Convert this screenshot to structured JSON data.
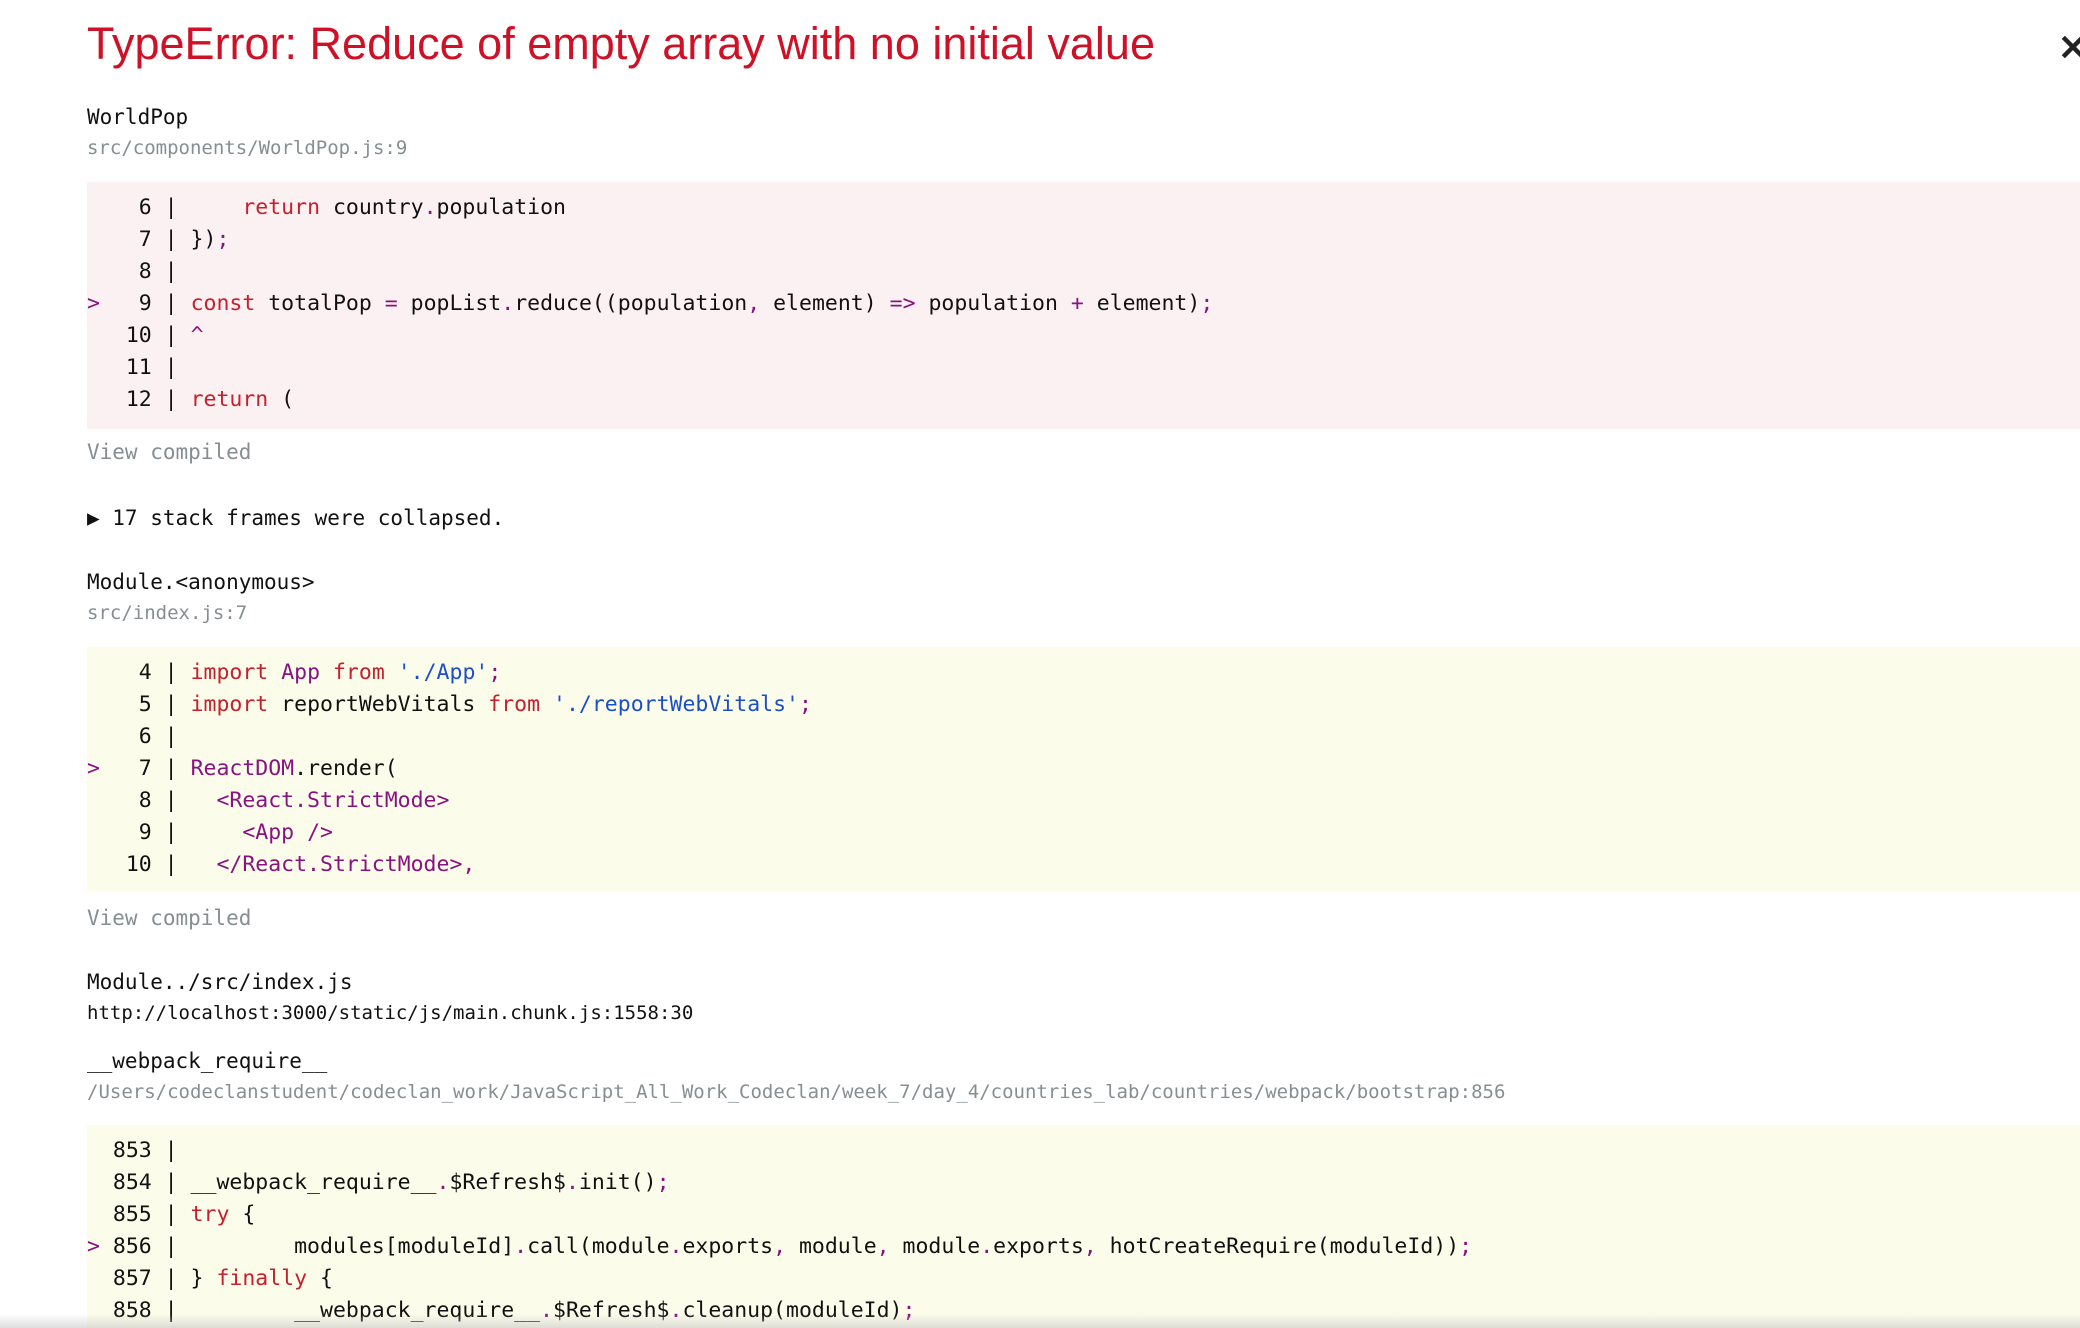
{
  "error": {
    "title": "TypeError: Reduce of empty array with no initial value",
    "close_glyph": "×"
  },
  "frames": [
    {
      "name": "WorldPop",
      "location": "src/components/WorldPop.js:9",
      "view_compiled": "View compiled"
    },
    {
      "collapsed_label": "▶ 17 stack frames were collapsed."
    },
    {
      "name": "Module.<anonymous>",
      "location": "src/index.js:7",
      "view_compiled": "View compiled"
    },
    {
      "name": "Module../src/index.js",
      "location": "http://localhost:3000/static/js/main.chunk.js:1558:30"
    },
    {
      "name": "__webpack_require__",
      "location": "/Users/codeclanstudent/codeclan_work/JavaScript_All_Work_Codeclan/week_7/day_4/countries_lab/countries/webpack/bootstrap:856"
    }
  ],
  "code_blocks": [
    {
      "highlight": "red",
      "lines": [
        [
          {
            "t": "    6 |     "
          },
          {
            "t": "return",
            "c": "k"
          },
          {
            "t": " country"
          },
          {
            "t": ".",
            "c": "p"
          },
          {
            "t": "population"
          }
        ],
        [
          {
            "t": "    7 | })"
          },
          {
            "t": ";",
            "c": "p"
          }
        ],
        [
          {
            "t": "    8 |"
          }
        ],
        [
          {
            "t": ">",
            "c": "p"
          },
          {
            "t": "   9 | "
          },
          {
            "t": "const",
            "c": "k"
          },
          {
            "t": " totalPop "
          },
          {
            "t": "=",
            "c": "p"
          },
          {
            "t": " popList"
          },
          {
            "t": ".",
            "c": "p"
          },
          {
            "t": "reduce((population"
          },
          {
            "t": ",",
            "c": "p"
          },
          {
            "t": " element) "
          },
          {
            "t": "=>",
            "c": "p"
          },
          {
            "t": " population "
          },
          {
            "t": "+",
            "c": "p"
          },
          {
            "t": " element)"
          },
          {
            "t": ";",
            "c": "p"
          }
        ],
        [
          {
            "t": "   10 | "
          },
          {
            "t": "^",
            "c": "p"
          }
        ],
        [
          {
            "t": "   11 |"
          }
        ],
        [
          {
            "t": "   12 | "
          },
          {
            "t": "return",
            "c": "k"
          },
          {
            "t": " ("
          }
        ]
      ]
    },
    {
      "highlight": "yellow",
      "lines": [
        [
          {
            "t": "    4 | "
          },
          {
            "t": "import",
            "c": "k"
          },
          {
            "t": " "
          },
          {
            "t": "App",
            "c": "p"
          },
          {
            "t": " "
          },
          {
            "t": "from",
            "c": "k"
          },
          {
            "t": " "
          },
          {
            "t": "'./App'",
            "c": "s"
          },
          {
            "t": ";",
            "c": "p"
          }
        ],
        [
          {
            "t": "    5 | "
          },
          {
            "t": "import",
            "c": "k"
          },
          {
            "t": " reportWebVitals "
          },
          {
            "t": "from",
            "c": "k"
          },
          {
            "t": " "
          },
          {
            "t": "'./reportWebVitals'",
            "c": "s"
          },
          {
            "t": ";",
            "c": "p"
          }
        ],
        [
          {
            "t": "    6 |"
          }
        ],
        [
          {
            "t": ">",
            "c": "p"
          },
          {
            "t": "   7 | "
          },
          {
            "t": "ReactDOM",
            "c": "p"
          },
          {
            "t": "."
          },
          {
            "t": "render("
          }
        ],
        [
          {
            "t": "    8 |   "
          },
          {
            "t": "<React.StrictMode>",
            "c": "p"
          }
        ],
        [
          {
            "t": "    9 |     "
          },
          {
            "t": "<App />",
            "c": "p"
          }
        ],
        [
          {
            "t": "   10 |   "
          },
          {
            "t": "</React.StrictMode>,",
            "c": "p"
          }
        ]
      ]
    },
    {
      "highlight": "yellow",
      "lines": [
        [
          {
            "t": "  853 |"
          }
        ],
        [
          {
            "t": "  854 | __webpack_require__"
          },
          {
            "t": ".",
            "c": "p"
          },
          {
            "t": "$Refresh$"
          },
          {
            "t": ".",
            "c": "p"
          },
          {
            "t": "init()"
          },
          {
            "t": ";",
            "c": "p"
          }
        ],
        [
          {
            "t": "  855 | "
          },
          {
            "t": "try",
            "c": "k"
          },
          {
            "t": " {"
          }
        ],
        [
          {
            "t": ">",
            "c": "p"
          },
          {
            "t": " 856 |         modules[moduleId]"
          },
          {
            "t": ".",
            "c": "p"
          },
          {
            "t": "call(module"
          },
          {
            "t": ".",
            "c": "p"
          },
          {
            "t": "exports"
          },
          {
            "t": ",",
            "c": "p"
          },
          {
            "t": " module"
          },
          {
            "t": ",",
            "c": "p"
          },
          {
            "t": " module"
          },
          {
            "t": ".",
            "c": "p"
          },
          {
            "t": "exports"
          },
          {
            "t": ",",
            "c": "p"
          },
          {
            "t": " hotCreateRequire(moduleId))"
          },
          {
            "t": ";",
            "c": "p"
          }
        ],
        [
          {
            "t": "  857 | } "
          },
          {
            "t": "finally",
            "c": "k"
          },
          {
            "t": " {"
          }
        ],
        [
          {
            "t": "  858 |         __webpack_require__"
          },
          {
            "t": ".",
            "c": "p"
          },
          {
            "t": "$Refresh$"
          },
          {
            "t": ".",
            "c": "p"
          },
          {
            "t": "cleanup(moduleId)"
          },
          {
            "t": ";",
            "c": "p"
          }
        ]
      ]
    }
  ],
  "colors": {
    "title_red": "#ce1126",
    "keyword_red": "#c5202d",
    "punctuation_purple": "#881280",
    "string_blue": "#1a4fc5",
    "muted_gray": "#878e91",
    "error_bg": "#fcf1f2",
    "context_bg": "#fcfceb"
  }
}
